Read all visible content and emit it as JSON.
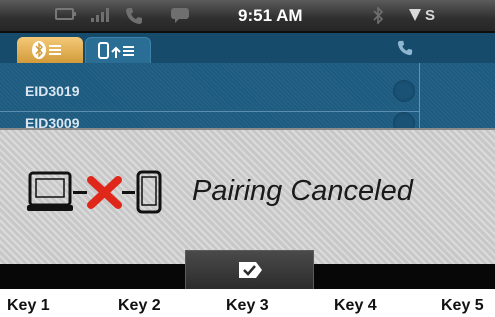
{
  "status_bar": {
    "time": "9:51 AM",
    "right_text": "S",
    "icons": [
      "battery-icon",
      "signal-icon",
      "phone-handset-icon",
      "message-icon",
      "bluetooth-icon",
      "network-strength-icon"
    ]
  },
  "background_screen": {
    "tabs": [
      {
        "icon": "bluetooth-list-icon",
        "selected": true
      },
      {
        "icon": "phone-transfer-icon",
        "selected": false
      }
    ],
    "devices": [
      "EID3019",
      "EID3009"
    ]
  },
  "popup": {
    "title": "Pairing Canceled",
    "illustration": "laptop-x-phone-icon"
  },
  "softkeys": {
    "confirm_icon": "check-icon",
    "labels": [
      "Key 1",
      "Key 2",
      "Key 3",
      "Key 4",
      "Key 5"
    ]
  },
  "colors": {
    "accent_tab": "#e0ad52",
    "screen_blue": "#1d5b80",
    "cancel_red": "#e0281a"
  }
}
